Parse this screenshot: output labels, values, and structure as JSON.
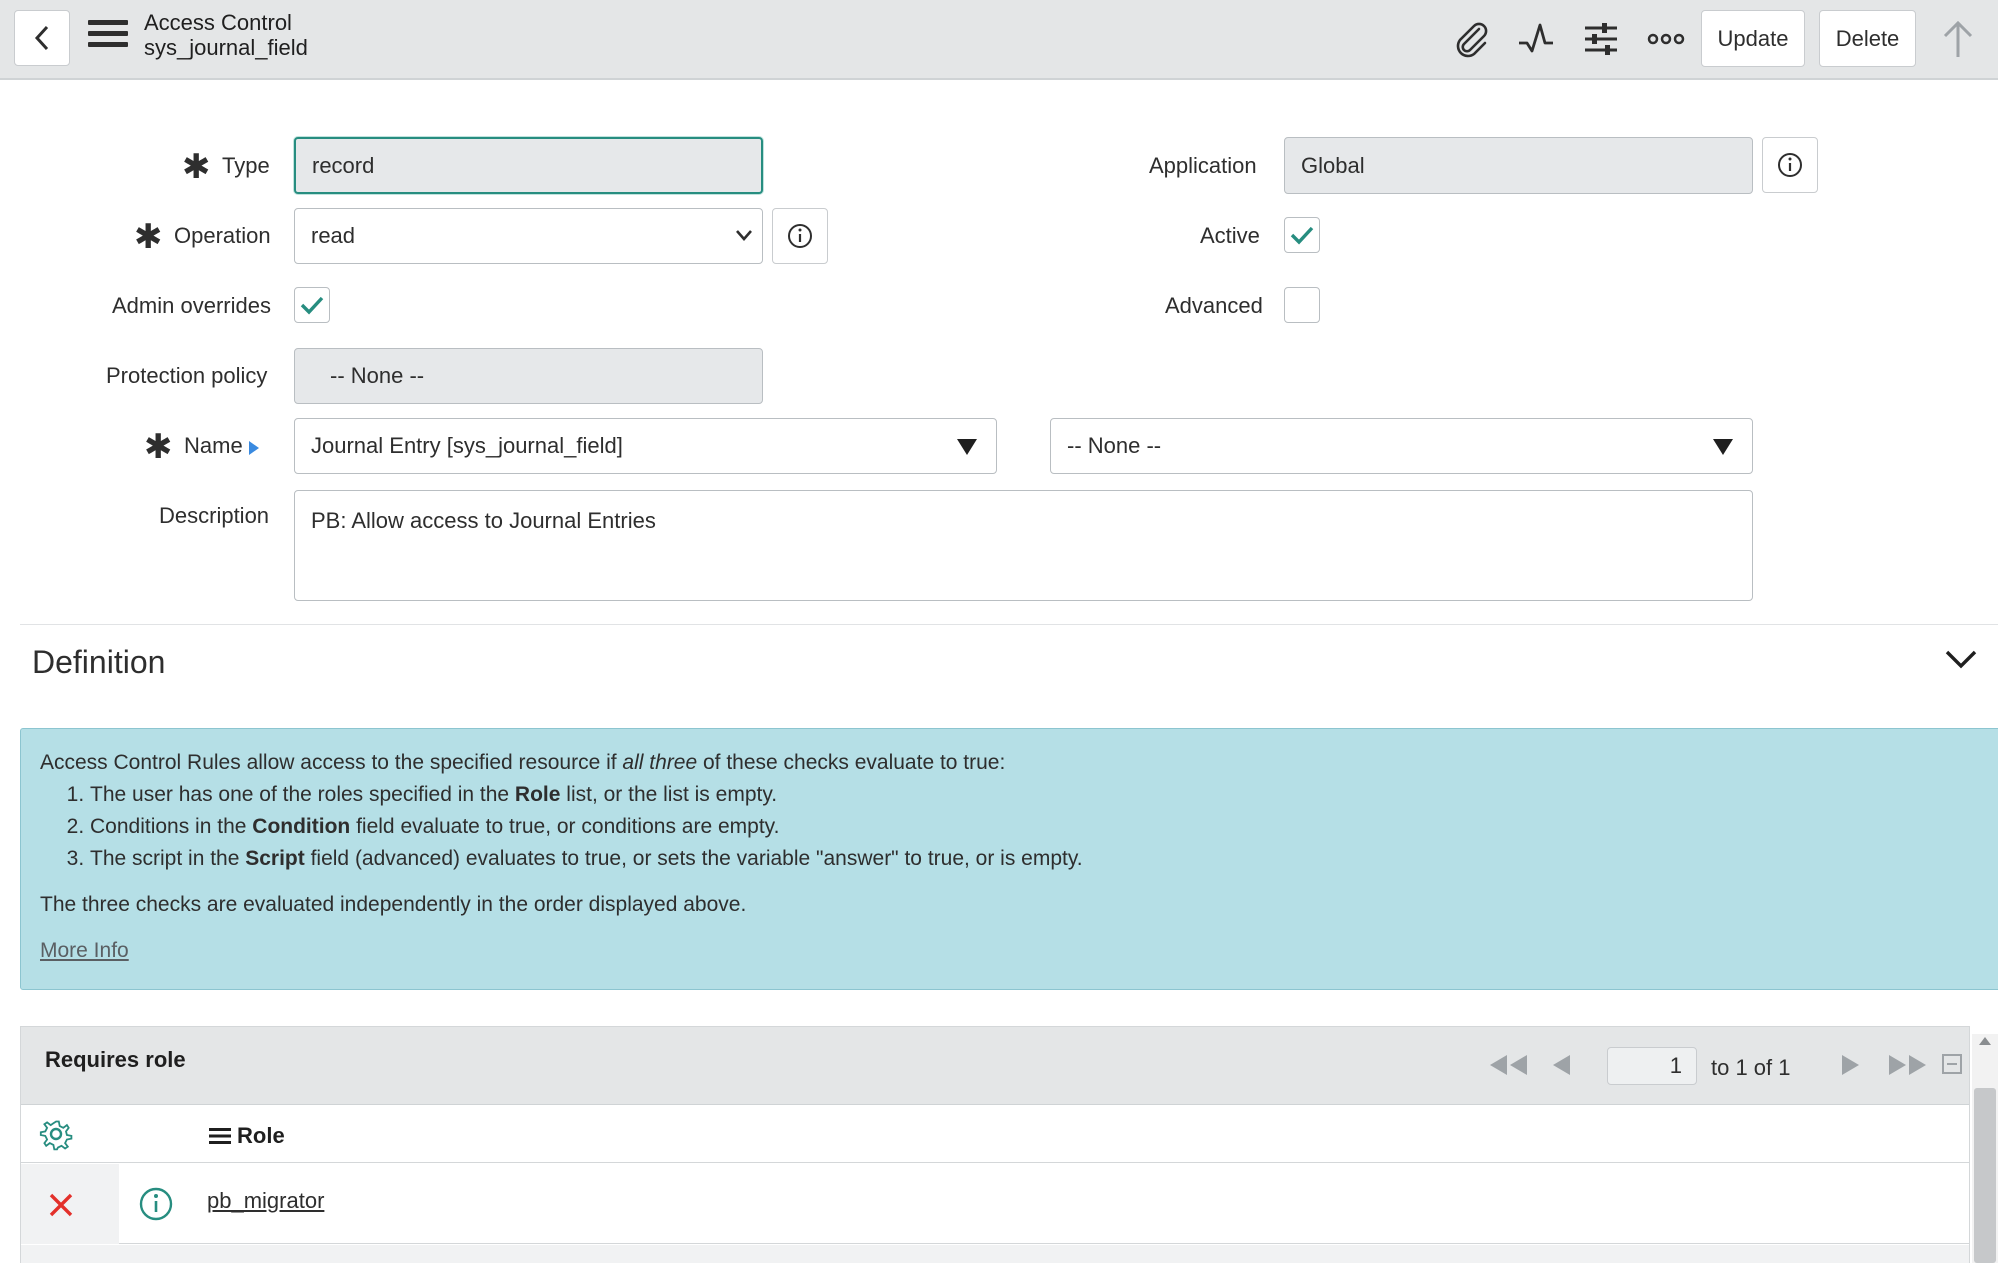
{
  "header": {
    "title": "Access Control",
    "subtitle": "sys_journal_field",
    "update_label": "Update",
    "delete_label": "Delete"
  },
  "form": {
    "type": {
      "label": "Type",
      "value": "record"
    },
    "operation": {
      "label": "Operation",
      "value": "read"
    },
    "admin_overrides": {
      "label": "Admin overrides",
      "checked": true
    },
    "protection_policy": {
      "label": "Protection policy",
      "value": "-- None --"
    },
    "name": {
      "label": "Name",
      "table_value": "Journal Entry [sys_journal_field]",
      "field_value": "-- None --"
    },
    "description": {
      "label": "Description",
      "value": "PB: Allow access to Journal Entries"
    },
    "application": {
      "label": "Application",
      "value": "Global"
    },
    "active": {
      "label": "Active",
      "checked": true
    },
    "advanced": {
      "label": "Advanced",
      "checked": false
    }
  },
  "definition": {
    "title": "Definition",
    "intro_before": "Access Control Rules allow access to the specified resource if ",
    "intro_em": "all three",
    "intro_after": " of these checks evaluate to true:",
    "items": [
      {
        "before": "The user has one of the roles specified in the ",
        "bold": "Role",
        "after": " list, or the list is empty."
      },
      {
        "before": "Conditions in the ",
        "bold": "Condition",
        "after": " field evaluate to true, or conditions are empty."
      },
      {
        "before": "The script in the ",
        "bold": "Script",
        "after": " field (advanced) evaluates to true, or sets the variable \"answer\" to true, or is empty."
      }
    ],
    "note": "The three checks are evaluated independently in the order displayed above.",
    "more_info": "More Info"
  },
  "related_list": {
    "title": "Requires role",
    "page_value": "1",
    "page_text": "to 1 of 1",
    "column_role": "Role",
    "rows": [
      {
        "role": "pb_migrator"
      }
    ]
  },
  "colors": {
    "accent": "#278d80",
    "delete_x": "#e3302a",
    "info_bg": "#b5dfe6"
  }
}
